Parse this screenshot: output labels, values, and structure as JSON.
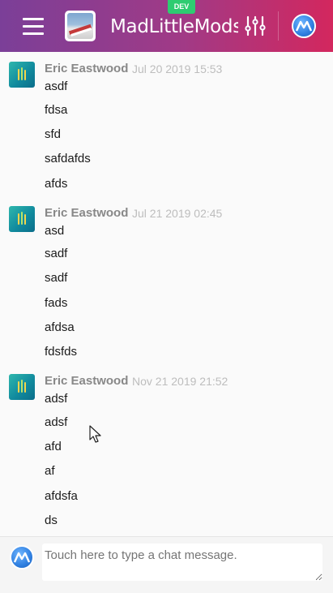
{
  "header": {
    "title": "MadLittleMods/r",
    "badge": "DEV",
    "menu_icon": "hamburger-menu-icon",
    "filter_icon": "sliders-icon"
  },
  "messages": [
    {
      "author": "Eric Eastwood",
      "time": "Jul 20 2019 15:53",
      "lines": [
        "asdf",
        "fdsa",
        "sfd",
        "safdafds",
        "afds"
      ]
    },
    {
      "author": "Eric Eastwood",
      "time": "Jul 21 2019 02:45",
      "lines": [
        "asd",
        "sadf",
        "sadf",
        "fads",
        "afdsa",
        "fdsfds"
      ]
    },
    {
      "author": "Eric Eastwood",
      "time": "Nov 21 2019 21:52",
      "lines": [
        "adsf",
        "adsf",
        "afd",
        "af",
        "afdsfa",
        "ds"
      ]
    }
  ],
  "composer": {
    "placeholder": "Touch here to type a chat message."
  },
  "colors": {
    "header_start": "#7b3f98",
    "header_end": "#d3275e",
    "badge": "#2ecc71"
  }
}
